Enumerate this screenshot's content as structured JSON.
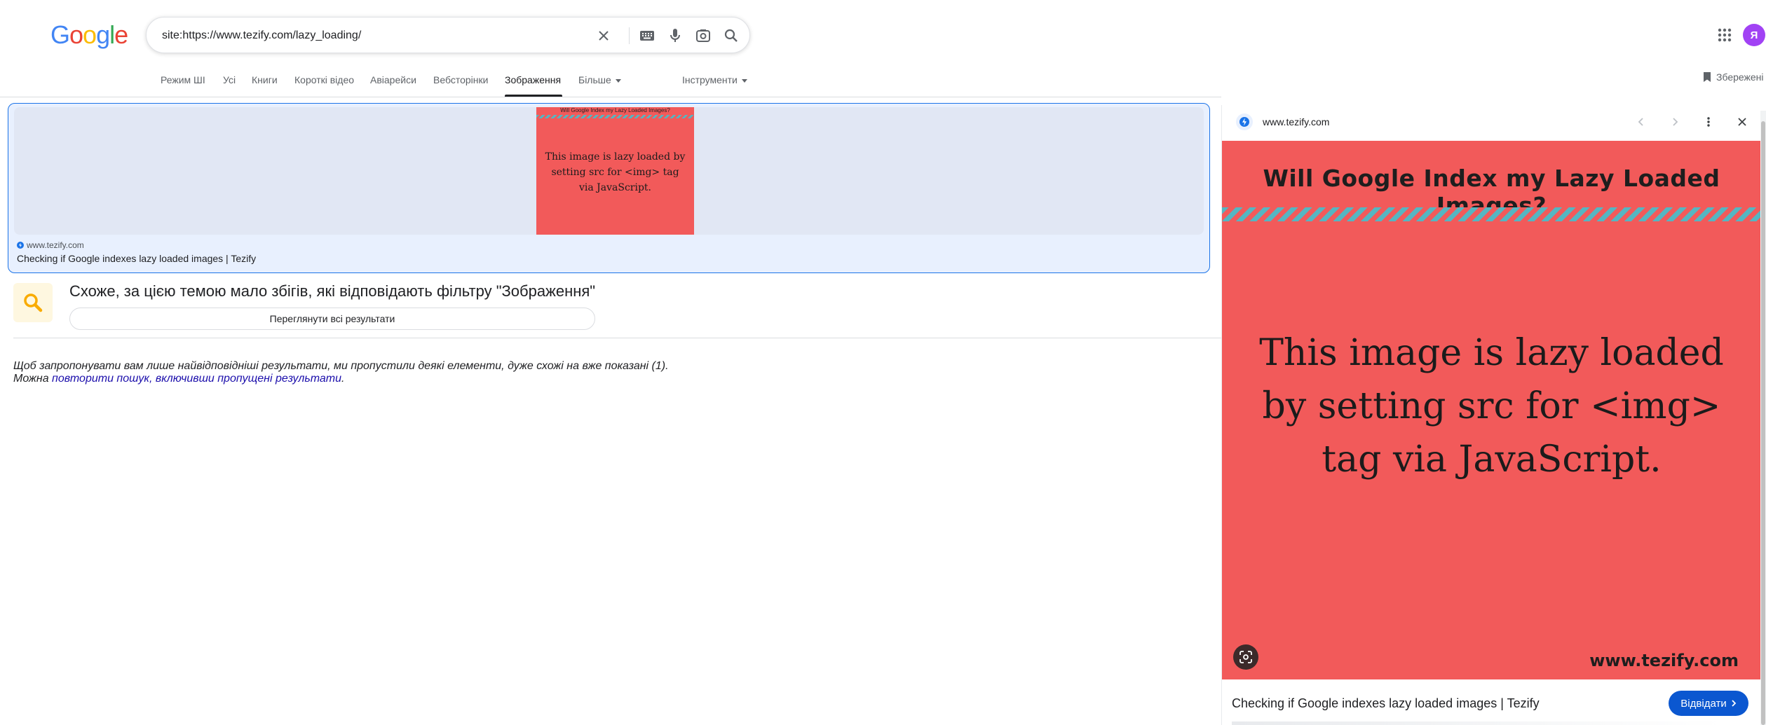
{
  "header": {
    "logo_letters": [
      "G",
      "o",
      "o",
      "g",
      "l",
      "e"
    ],
    "search_value": "site:https://www.tezify.com/lazy_loading/",
    "avatar_letter": "Я"
  },
  "tabs": [
    {
      "label": "Режим ШІ"
    },
    {
      "label": "Усі"
    },
    {
      "label": "Книги"
    },
    {
      "label": "Короткі відео"
    },
    {
      "label": "Авіарейси"
    },
    {
      "label": "Вебсторінки"
    },
    {
      "label": "Зображення",
      "active": true
    },
    {
      "label": "Більше"
    },
    {
      "label": "Інструменти"
    }
  ],
  "saved_label": "Збережені",
  "result": {
    "source": "www.tezify.com",
    "title": "Checking if Google indexes lazy loaded images | Tezify",
    "thumb_title": "Will Google Index my Lazy Loaded Images?",
    "thumb_text": "This image is lazy loaded by setting src for <img> tag via JavaScript."
  },
  "notice": {
    "heading": "Схоже, за цією темою мало збігів, які відповідають фільтру \"Зображення\"",
    "button_label": "Переглянути всі результати",
    "omitted_line1": "Щоб запропонувати вам лише найвідповідніші результати, ми пропустили деякі елементи, дуже схожі на вже показані (1).",
    "omitted_prefix": "Можна ",
    "omitted_link": "повторити пошук, включивши пропущені результати",
    "omitted_suffix": "."
  },
  "panel": {
    "domain": "www.tezify.com",
    "image_title": "Will Google Index my Lazy Loaded Images?",
    "image_text": "This image is lazy loaded by setting src for <img> tag via JavaScript.",
    "image_domain": "www.tezify.com",
    "title": "Checking if Google indexes lazy loaded images | Tezify",
    "visit_label": "Відвідати"
  },
  "colors": {
    "accent": "#1a73e8",
    "image_background": "#f25a5a",
    "stripe": "#55b6c2",
    "visit_button": "#0b57d0"
  },
  "icons": [
    "clear-icon",
    "keyboard-icon",
    "microphone-icon",
    "lens-icon",
    "search-icon",
    "apps-grid-icon",
    "bookmark-icon",
    "chevron-left-icon",
    "chevron-right-icon",
    "more-vert-icon",
    "close-icon"
  ]
}
